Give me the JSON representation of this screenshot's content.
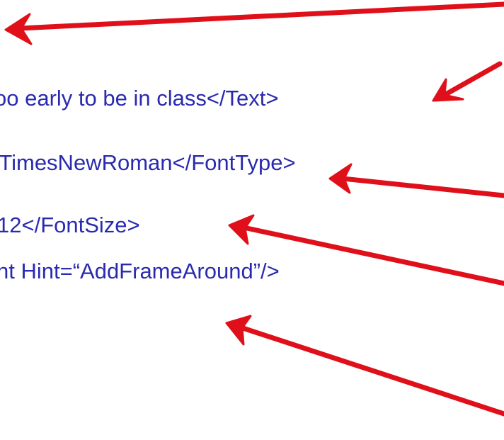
{
  "slide": {
    "lines": {
      "text": "oo early to be in class</Text>",
      "font_type": "-TimesNewRoman</FontType>",
      "font_size": "12</FontSize>",
      "hint": "nt Hint=“AddFrameAround”/>"
    }
  },
  "colors": {
    "code_text": "#2a2ab0",
    "arrow": "#e0101a"
  },
  "icons": [
    "arrow-icon"
  ]
}
